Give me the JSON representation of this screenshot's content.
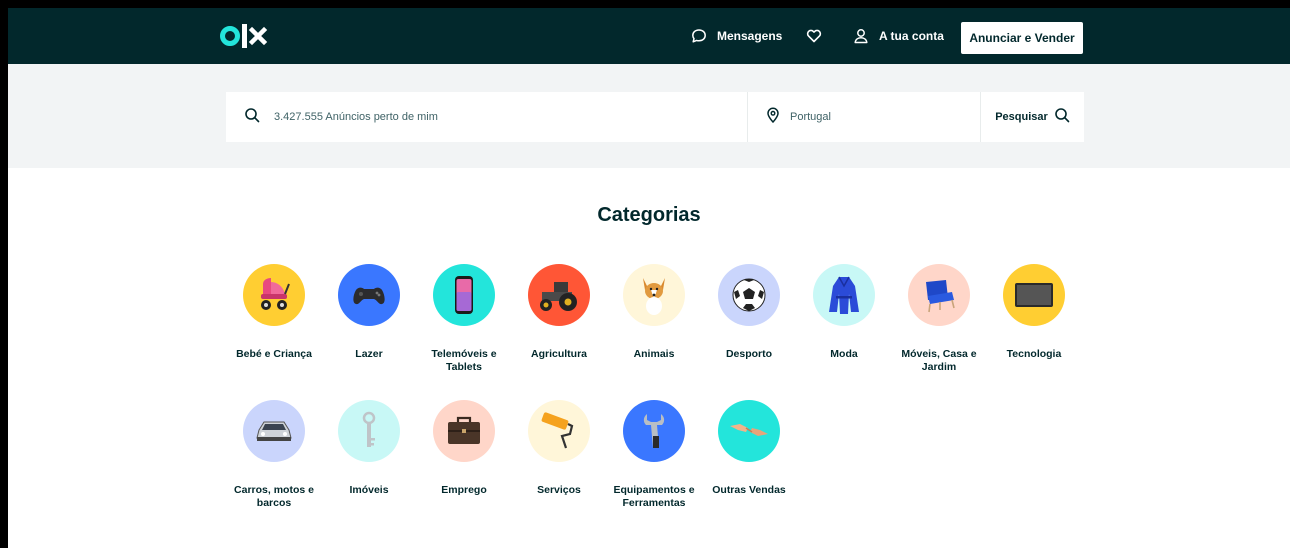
{
  "header": {
    "logo_text": "olx",
    "messages_label": "Mensagens",
    "favorites_icon": "heart-icon",
    "account_label": "A tua conta",
    "post_button_label": "Anunciar e Vender"
  },
  "search": {
    "query_placeholder": "3.427.555 Anúncios perto de mim",
    "location_value": "Portugal",
    "submit_label": "Pesquisar"
  },
  "categories": {
    "title": "Categorias",
    "items": [
      {
        "label": "Bebé e Criança",
        "color": "#ffce32",
        "icon": "stroller-icon"
      },
      {
        "label": "Lazer",
        "color": "#3a77ff",
        "icon": "gamepad-icon"
      },
      {
        "label": "Telemóveis e Tablets",
        "color": "#23e5db",
        "icon": "smartphone-icon"
      },
      {
        "label": "Agricultura",
        "color": "#ff5636",
        "icon": "tractor-icon"
      },
      {
        "label": "Animais",
        "color": "#fff6d9",
        "icon": "dog-icon"
      },
      {
        "label": "Desporto",
        "color": "#cad5fc",
        "icon": "soccer-ball-icon"
      },
      {
        "label": "Moda",
        "color": "#c8f8f6",
        "icon": "coat-icon"
      },
      {
        "label": "Móveis, Casa e Jardim",
        "color": "#ffd6c9",
        "icon": "armchair-icon"
      },
      {
        "label": "Tecnologia",
        "color": "#ffce32",
        "icon": "tv-icon"
      },
      {
        "label": "Carros, motos e barcos",
        "color": "#cad5fc",
        "icon": "car-icon"
      },
      {
        "label": "Imóveis",
        "color": "#c8f8f6",
        "icon": "key-icon"
      },
      {
        "label": "Emprego",
        "color": "#ffd6c9",
        "icon": "briefcase-icon"
      },
      {
        "label": "Serviços",
        "color": "#fff6d9",
        "icon": "paint-roller-icon"
      },
      {
        "label": "Equipamentos e Ferramentas",
        "color": "#3a77ff",
        "icon": "wrench-icon"
      },
      {
        "label": "Outras Vendas",
        "color": "#23e5db",
        "icon": "handshake-icon"
      }
    ]
  }
}
